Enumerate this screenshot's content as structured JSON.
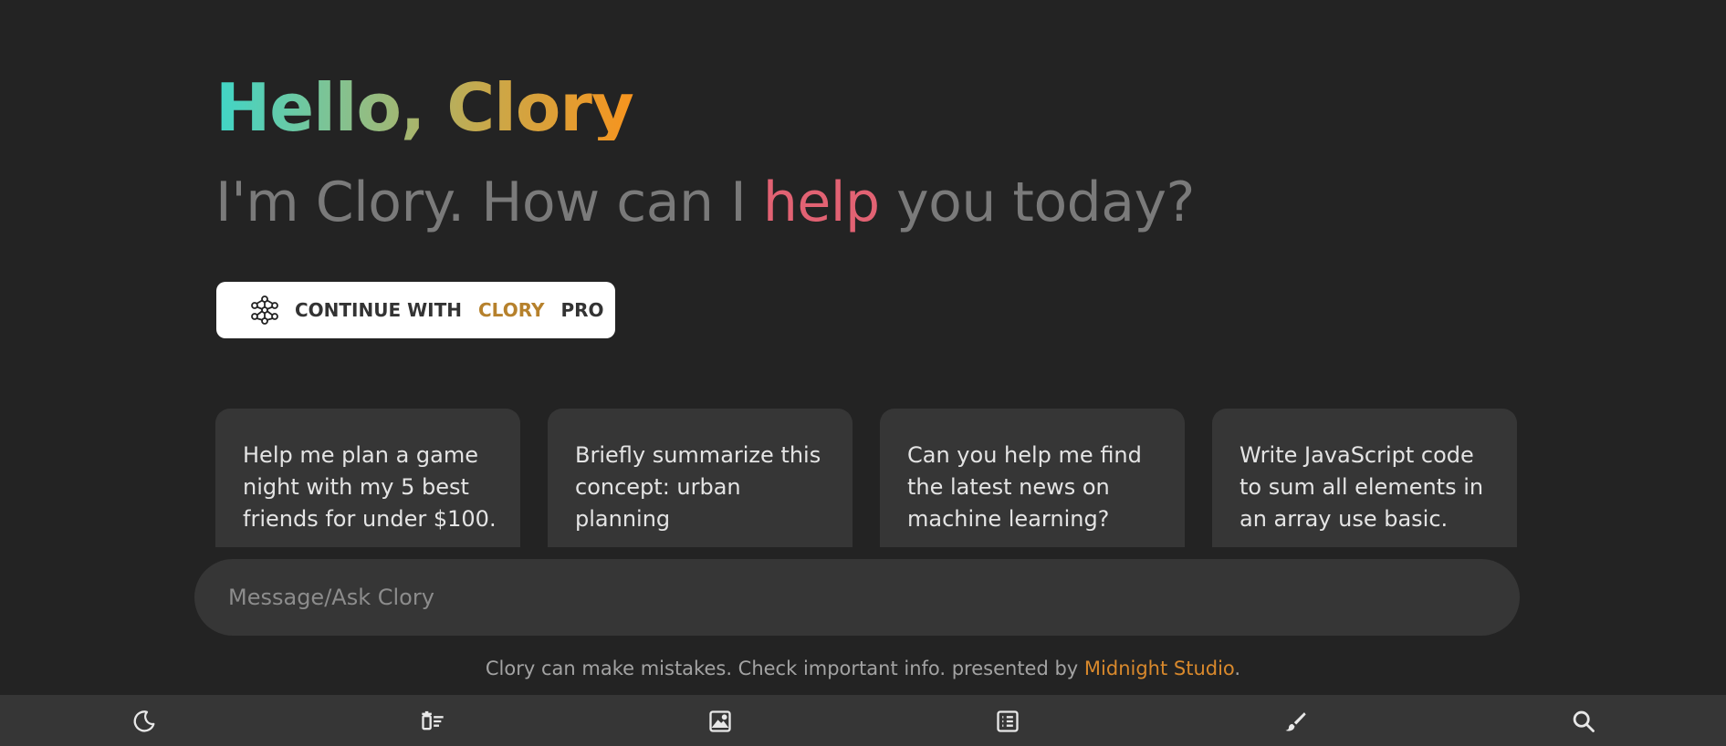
{
  "greeting": {
    "text": "Hello, Clory"
  },
  "subtitle": {
    "before": "I'm Clory. How can I ",
    "accent": "help",
    "after": " you today?"
  },
  "pro_button": {
    "prefix": "CONTINUE WITH",
    "brand": "CLORY",
    "suffix": "PRO",
    "icon": "network-nodes-icon"
  },
  "suggestions": [
    {
      "text": "Help me plan a game night with my 5 best friends for under $100."
    },
    {
      "text": "Briefly summarize this concept: urban planning"
    },
    {
      "text": "Can you help me find the latest news on machine learning?"
    },
    {
      "text": "Write JavaScript code to sum all elements in an array use basic."
    }
  ],
  "prompt": {
    "placeholder": "Message/Ask Clory",
    "value": ""
  },
  "footer": {
    "note": "Clory can make mistakes. Check important info. presented by ",
    "studio": "Midnight Studio",
    "end": "."
  },
  "toolbar": {
    "items": [
      {
        "icon": "moon-icon"
      },
      {
        "icon": "delete-list-icon"
      },
      {
        "icon": "image-icon"
      },
      {
        "icon": "list-icon"
      },
      {
        "icon": "brush-icon"
      },
      {
        "icon": "search-icon"
      }
    ]
  },
  "colors": {
    "background": "#232323",
    "surface": "#363636",
    "accent_red": "#e26273",
    "accent_orange": "#d9892c",
    "brand_gold": "#b6812c",
    "gradient_start": "#3fd6c8",
    "gradient_end": "#f7941e"
  }
}
